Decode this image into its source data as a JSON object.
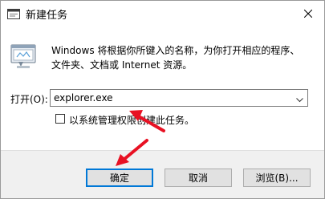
{
  "window": {
    "title": "新建任务",
    "icon": "run-dialog-icon",
    "close_icon": "close-icon"
  },
  "content": {
    "description_line1": "Windows 将根据你所键入的名称，为你打开相应的程序、",
    "description_line2": "文件夹、文档或 Internet 资源。",
    "open_label": "打开(O):",
    "open_value": "explorer.exe",
    "admin_checkbox_label": "以系统管理权限创建此任务。",
    "admin_checked": false
  },
  "buttons": {
    "ok": "确定",
    "cancel": "取消",
    "browse": "浏览(B)..."
  },
  "colors": {
    "accent": "#0078d7",
    "annotation": "#e81123",
    "footer_bg": "#f0f0f0"
  }
}
